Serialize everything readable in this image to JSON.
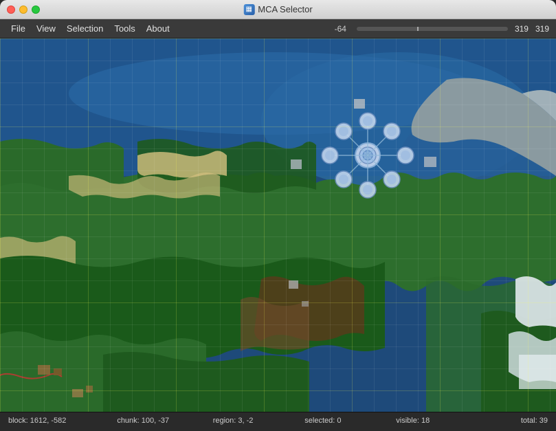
{
  "titleBar": {
    "appName": "MCA Selector",
    "icon": "grid-icon"
  },
  "menuBar": {
    "items": [
      "File",
      "View",
      "Selection",
      "Tools",
      "About"
    ],
    "coordDisplay": {
      "value": "-64",
      "right1": "319",
      "right2": "319"
    }
  },
  "statusBar": {
    "block": "block: 1612, -582",
    "chunk": "chunk: 100, -37",
    "region": "region: 3, -2",
    "selected": "selected: 0",
    "visible": "visible: 18",
    "total": "total: 39"
  },
  "map": {
    "backgroundColor": "#1a3a5c"
  },
  "icons": {
    "beacon": "⬡",
    "app": "▦"
  }
}
